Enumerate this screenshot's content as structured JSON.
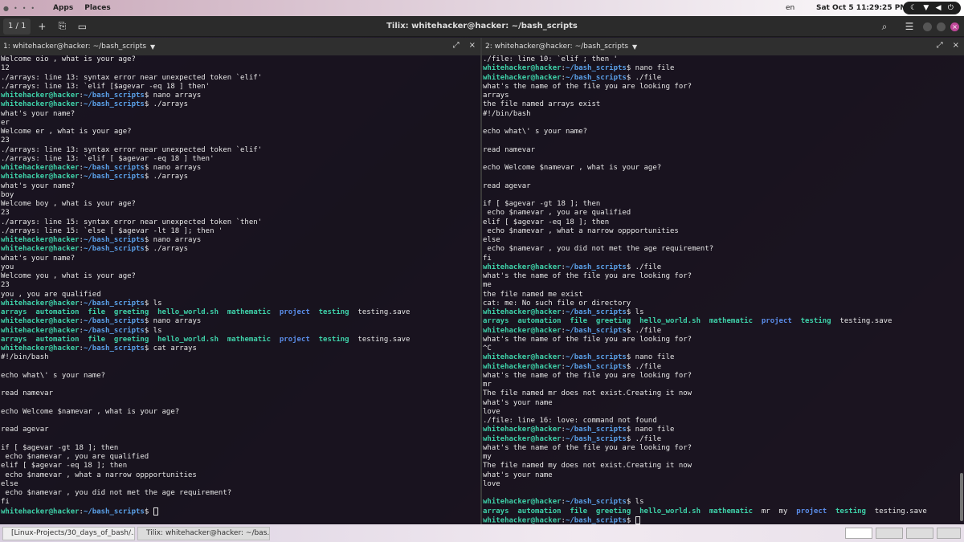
{
  "topbar": {
    "activities_dots": [
      "●",
      "•",
      "•",
      "•"
    ],
    "apps": "Apps",
    "places": "Places",
    "lang": "en",
    "clock": "Sat Oct 5  11:29:25 PM",
    "tray_icons": [
      "moon-icon",
      "wifi-icon",
      "volume-icon",
      "power-icon"
    ]
  },
  "header": {
    "session_label": "1 / 1",
    "title": "Tilix: whitehacker@hacker: ~/bash_scripts"
  },
  "left": {
    "title": "1: whitehacker@hacker: ~/bash_scripts",
    "prompt_user": "whitehacker@hacker",
    "prompt_path": "~/bash_scripts",
    "lines": [
      {
        "t": "Welcome oio , what is your age?"
      },
      {
        "t": "12"
      },
      {
        "t": "./arrays: line 13: syntax error near unexpected token `elif'"
      },
      {
        "t": "./arrays: line 13: `elif [$agevar -eq 18 ] then'"
      },
      {
        "p": true,
        "t": "nano arrays"
      },
      {
        "p": true,
        "t": "./arrays"
      },
      {
        "t": "what's your name?"
      },
      {
        "t": "er"
      },
      {
        "t": "Welcome er , what is your age?"
      },
      {
        "t": "23"
      },
      {
        "t": "./arrays: line 13: syntax error near unexpected token `elif'"
      },
      {
        "t": "./arrays: line 13: `elif [ $agevar -eq 18 ] then'"
      },
      {
        "p": true,
        "t": "nano arrays"
      },
      {
        "p": true,
        "t": "./arrays"
      },
      {
        "t": "what's your name?"
      },
      {
        "t": "boy"
      },
      {
        "t": "Welcome boy , what is your age?"
      },
      {
        "t": "23"
      },
      {
        "t": "./arrays: line 15: syntax error near unexpected token `then'"
      },
      {
        "t": "./arrays: line 15: `else [ $agevar -lt 18 ]; then '"
      },
      {
        "p": true,
        "t": "nano arrays"
      },
      {
        "p": true,
        "t": "./arrays"
      },
      {
        "t": "what's your name?"
      },
      {
        "t": "you"
      },
      {
        "t": "Welcome you , what is your age?"
      },
      {
        "t": "23"
      },
      {
        "t": "you , you are qualified"
      },
      {
        "p": true,
        "t": "ls"
      },
      {
        "ls": [
          [
            "arrays",
            "exec"
          ],
          [
            "automation",
            "exec"
          ],
          [
            "file",
            "exec"
          ],
          [
            "greeting",
            "exec"
          ],
          [
            "hello_world.sh",
            "exec"
          ],
          [
            "mathematic",
            "exec"
          ],
          [
            "project",
            "dir"
          ],
          [
            "testing",
            "exec"
          ],
          [
            "testing.save",
            "plain"
          ]
        ]
      },
      {
        "p": true,
        "t": "nano arrays"
      },
      {
        "p": true,
        "t": "ls"
      },
      {
        "ls": [
          [
            "arrays",
            "exec"
          ],
          [
            "automation",
            "exec"
          ],
          [
            "file",
            "exec"
          ],
          [
            "greeting",
            "exec"
          ],
          [
            "hello_world.sh",
            "exec"
          ],
          [
            "mathematic",
            "exec"
          ],
          [
            "project",
            "dir"
          ],
          [
            "testing",
            "exec"
          ],
          [
            "testing.save",
            "plain"
          ]
        ]
      },
      {
        "p": true,
        "t": "cat arrays"
      },
      {
        "t": "#!/bin/bash"
      },
      {
        "t": ""
      },
      {
        "t": "echo what\\' s your name?"
      },
      {
        "t": ""
      },
      {
        "t": "read namevar"
      },
      {
        "t": ""
      },
      {
        "t": "echo Welcome $namevar , what is your age?"
      },
      {
        "t": ""
      },
      {
        "t": "read agevar"
      },
      {
        "t": ""
      },
      {
        "t": "if [ $agevar -gt 18 ]; then"
      },
      {
        "t": " echo $namevar , you are qualified"
      },
      {
        "t": "elif [ $agevar -eq 18 ]; then"
      },
      {
        "t": " echo $namevar , what a narrow oppportunities"
      },
      {
        "t": "else"
      },
      {
        "t": " echo $namevar , you did not met the age requirement?"
      },
      {
        "t": "fi"
      },
      {
        "p": true,
        "t": "",
        "cursor": true
      }
    ]
  },
  "right": {
    "title": "2: whitehacker@hacker: ~/bash_scripts",
    "prompt_user": "whitehacker@hacker",
    "prompt_path": "~/bash_scripts",
    "lines": [
      {
        "t": "./file: line 10: `elif ; then '"
      },
      {
        "p": true,
        "t": "nano file"
      },
      {
        "p": true,
        "t": "./file"
      },
      {
        "t": "what's the name of the file you are looking for?"
      },
      {
        "t": "arrays"
      },
      {
        "t": "the file named arrays exist"
      },
      {
        "t": "#!/bin/bash"
      },
      {
        "t": ""
      },
      {
        "t": "echo what\\' s your name?"
      },
      {
        "t": ""
      },
      {
        "t": "read namevar"
      },
      {
        "t": ""
      },
      {
        "t": "echo Welcome $namevar , what is your age?"
      },
      {
        "t": ""
      },
      {
        "t": "read agevar"
      },
      {
        "t": ""
      },
      {
        "t": "if [ $agevar -gt 18 ]; then"
      },
      {
        "t": " echo $namevar , you are qualified"
      },
      {
        "t": "elif [ $agevar -eq 18 ]; then"
      },
      {
        "t": " echo $namevar , what a narrow oppportunities"
      },
      {
        "t": "else"
      },
      {
        "t": " echo $namevar , you did not met the age requirement?"
      },
      {
        "t": "fi"
      },
      {
        "p": true,
        "t": "./file"
      },
      {
        "t": "what's the name of the file you are looking for?"
      },
      {
        "t": "me"
      },
      {
        "t": "the file named me exist"
      },
      {
        "t": "cat: me: No such file or directory"
      },
      {
        "p": true,
        "t": "ls"
      },
      {
        "ls": [
          [
            "arrays",
            "exec"
          ],
          [
            "automation",
            "exec"
          ],
          [
            "file",
            "exec"
          ],
          [
            "greeting",
            "exec"
          ],
          [
            "hello_world.sh",
            "exec"
          ],
          [
            "mathematic",
            "exec"
          ],
          [
            "project",
            "dir"
          ],
          [
            "testing",
            "exec"
          ],
          [
            "testing.save",
            "plain"
          ]
        ]
      },
      {
        "p": true,
        "t": "./file"
      },
      {
        "t": "what's the name of the file you are looking for?"
      },
      {
        "t": "^C"
      },
      {
        "p": true,
        "t": "nano file"
      },
      {
        "p": true,
        "t": "./file"
      },
      {
        "t": "what's the name of the file you are looking for?"
      },
      {
        "t": "mr"
      },
      {
        "t": "The file named mr does not exist.Creating it now"
      },
      {
        "t": "what's your name"
      },
      {
        "t": "love"
      },
      {
        "t": "./file: line 16: love: command not found"
      },
      {
        "p": true,
        "t": "nano file"
      },
      {
        "p": true,
        "t": "./file"
      },
      {
        "t": "what's the name of the file you are looking for?"
      },
      {
        "t": "my"
      },
      {
        "t": "The file named my does not exist.Creating it now"
      },
      {
        "t": "what's your name"
      },
      {
        "t": "love"
      },
      {
        "t": ""
      },
      {
        "p": true,
        "t": "ls"
      },
      {
        "ls": [
          [
            "arrays",
            "exec"
          ],
          [
            "automation",
            "exec"
          ],
          [
            "file",
            "exec"
          ],
          [
            "greeting",
            "exec"
          ],
          [
            "hello_world.sh",
            "exec"
          ],
          [
            "mathematic",
            "exec"
          ],
          [
            "mr",
            "plain"
          ],
          [
            "my",
            "plain"
          ],
          [
            "project",
            "dir"
          ],
          [
            "testing",
            "exec"
          ],
          [
            "testing.save",
            "plain"
          ]
        ]
      },
      {
        "p": true,
        "t": "",
        "cursor": true
      }
    ]
  },
  "taskbar": {
    "tasks": [
      {
        "label": "[Linux-Projects/30_days_of_bash/...",
        "icon": "chrome-icon",
        "color": "#d44"
      },
      {
        "label": "Tilix: whitehacker@hacker: ~/bas...",
        "icon": "terminal-icon",
        "color": "#333"
      }
    ]
  }
}
